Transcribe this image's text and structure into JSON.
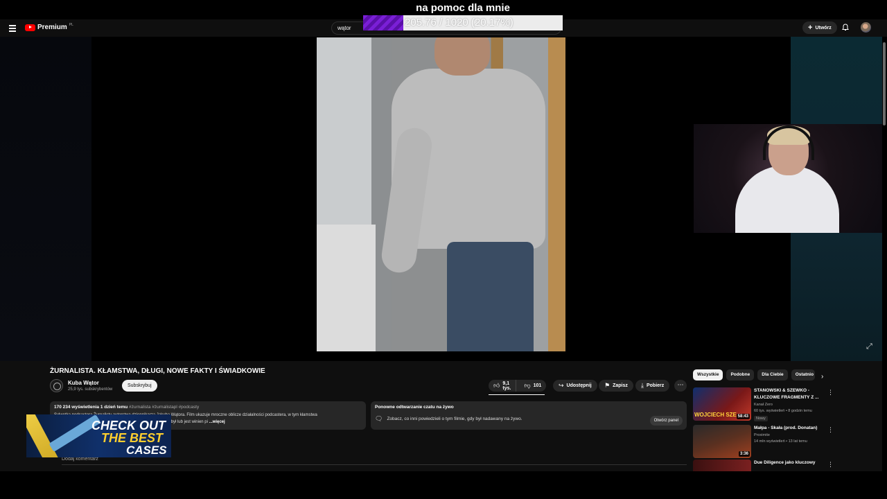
{
  "overlay": {
    "title": "na pomoc dla mnie",
    "progress_text": "205.76 / 1020 (20.17%)",
    "progress_fraction": 0.2017,
    "progress_color": "#7a1fd6"
  },
  "header": {
    "brand": "Premium",
    "region": "PL",
    "search_value": "wątor",
    "create_label": "Utwórz",
    "icons": [
      "menu-icon",
      "youtube-logo",
      "plus-icon",
      "bell-icon",
      "avatar"
    ]
  },
  "video": {
    "title": "ŻURNALISTA. KŁAMSTWA, DŁUGI, NOWE FAKTY I ŚWIADKOWIE",
    "channel": "Kuba Wątor",
    "subscribers": "25,9 tys. subskrybentów",
    "subscribe_label": "Subskrybuj",
    "likes": "9,1 tys.",
    "dislikes": "101",
    "share_label": "Udostępnij",
    "save_label": "Zapisz",
    "download_label": "Pobierz",
    "more_label": "⋯"
  },
  "description": {
    "meta": "170 234 wyświetlenia  1 dzień temu",
    "tags": "#żurnalista #żurnalistapl #podcasty",
    "line1": "Sylwetka podcastera Żurnalisty autorstwa dziennikarza Jakuba Wątora. Film ukazuje mroczne oblicze działalności podcastera, w tym kłamstwa",
    "line2": "i długi. W filmie wypowiadają się m.in. osoby, którym Żurnalista był lub jest winien pi",
    "more": "...więcej"
  },
  "chat_replay": {
    "title": "Ponowne odtwarzanie czatu na żywo",
    "text": "Zobacz, co inni powiedzieli o tym filmie, gdy był nadawany na żywo.",
    "button": "Otwórz panel"
  },
  "comments": {
    "add_label": "Dodaj komentarz"
  },
  "ad": {
    "line1": "CHECK OUT",
    "line2": "THE BEST",
    "line3": "CASES",
    "accent": "#ffcf2e"
  },
  "chips": [
    "Wszystkie",
    "Podobne",
    "Dla Ciebie",
    "Ostatnio"
  ],
  "recommendations": [
    {
      "title": "STANOWSKI & SZEWKO - KLUCZOWE FRAGMENTY Z ...",
      "channel": "Kanał Zero",
      "meta": "60 tys. wyświetleń • 8 godzin temu",
      "badge": "Nowy",
      "duration": "58:43",
      "thumb_text": "WOJCIECH SZE"
    },
    {
      "title": "Małpa - Skała (prod. Donatan)",
      "channel": "Proximite",
      "meta": "14 mln wyświetleń • 13 lat temu",
      "badge": "",
      "duration": "3:36",
      "thumb_text": ""
    },
    {
      "title": "Due Diligence jako kluczowy",
      "channel": "",
      "meta": "",
      "badge": "",
      "duration": "",
      "thumb_text": ""
    }
  ]
}
